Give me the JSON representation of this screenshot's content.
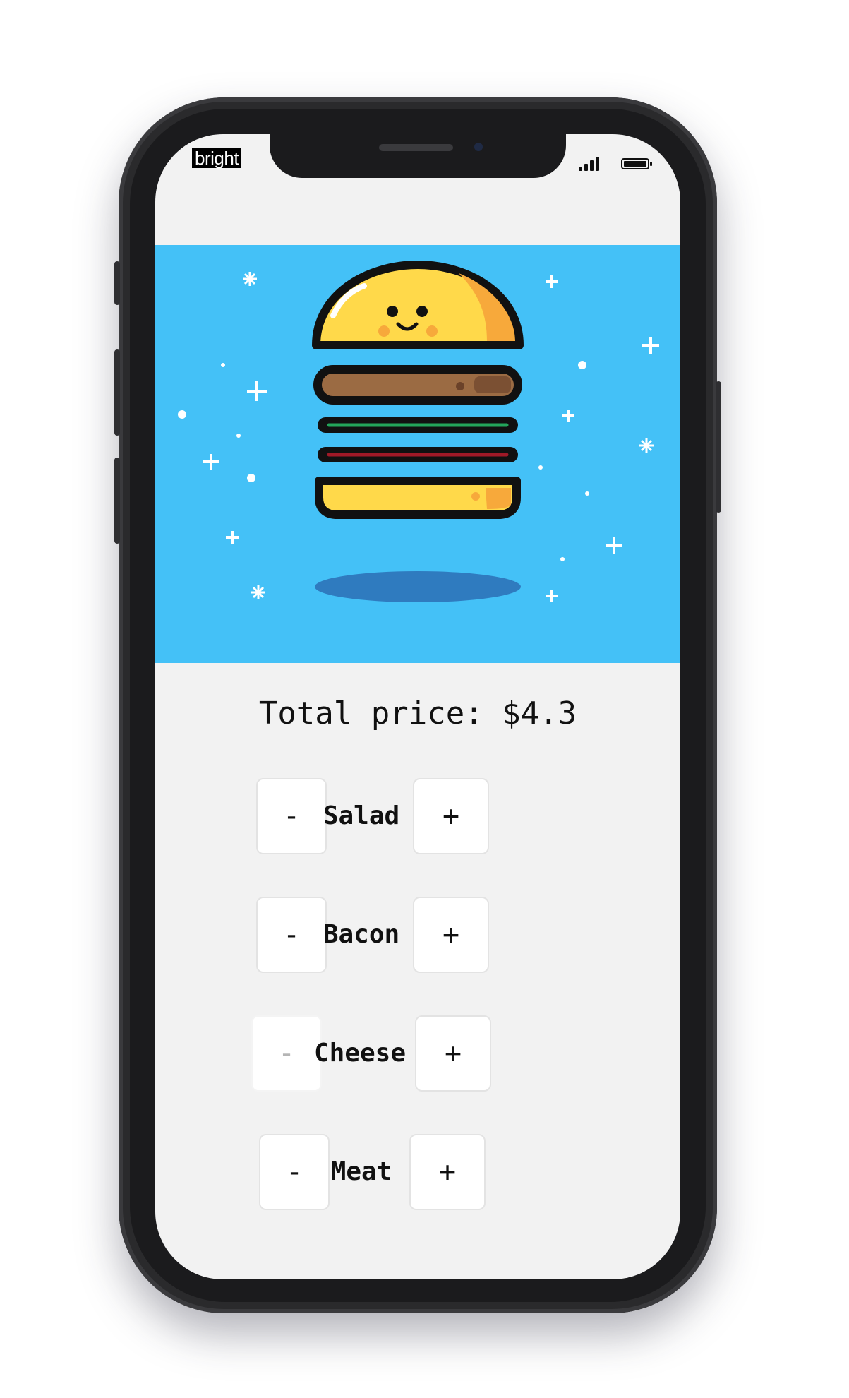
{
  "status_bar": {
    "brand": "bright"
  },
  "hero": {
    "image": "cute-burger-illustration",
    "background": "#44c1f7"
  },
  "summary": {
    "total_price": "Total price: $4.3"
  },
  "ingredients": [
    {
      "label": "Salad",
      "decrement": "-",
      "increment": "+",
      "decrement_enabled": true
    },
    {
      "label": "Bacon",
      "decrement": "-",
      "increment": "+",
      "decrement_enabled": true
    },
    {
      "label": "Cheese",
      "decrement": "-",
      "increment": "+",
      "decrement_enabled": false
    },
    {
      "label": "Meat",
      "decrement": "-",
      "increment": "+",
      "decrement_enabled": true
    }
  ],
  "colors": {
    "bun": "#ffd94a",
    "bun_shade": "#f7a93b",
    "patty": "#9b6b43",
    "salad": "#23a55a",
    "bacon": "#a01927",
    "outline": "#111111",
    "shadow": "#2f7bbf"
  }
}
